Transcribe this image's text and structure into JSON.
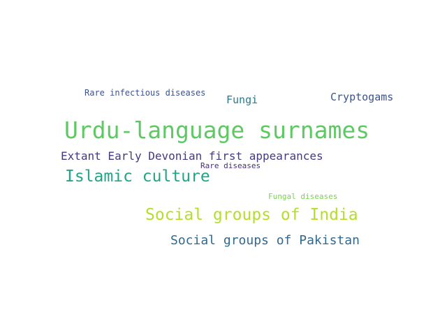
{
  "word_cloud": {
    "words": [
      {
        "key": "urdu",
        "text": "Urdu-language surnames",
        "color": "#5ec962"
      },
      {
        "key": "extant",
        "text": "Extant Early Devonian first appearances",
        "color": "#443983"
      },
      {
        "key": "islamic",
        "text": "Islamic culture",
        "color": "#21a585"
      },
      {
        "key": "rare_infectious",
        "text": "Rare infectious diseases",
        "color": "#3b528b"
      },
      {
        "key": "fungi",
        "text": "Fungi",
        "color": "#2a788e"
      },
      {
        "key": "cryptogams",
        "text": "Cryptogams",
        "color": "#3b528b"
      },
      {
        "key": "rare_diseases",
        "text": "Rare diseases",
        "color": "#472d7b"
      },
      {
        "key": "fungal_diseases",
        "text": "Fungal diseases",
        "color": "#7ad151"
      },
      {
        "key": "india",
        "text": "Social groups of India",
        "color": "#b5de2b"
      },
      {
        "key": "pakistan",
        "text": "Social groups of Pakistan",
        "color": "#31688e"
      }
    ]
  }
}
